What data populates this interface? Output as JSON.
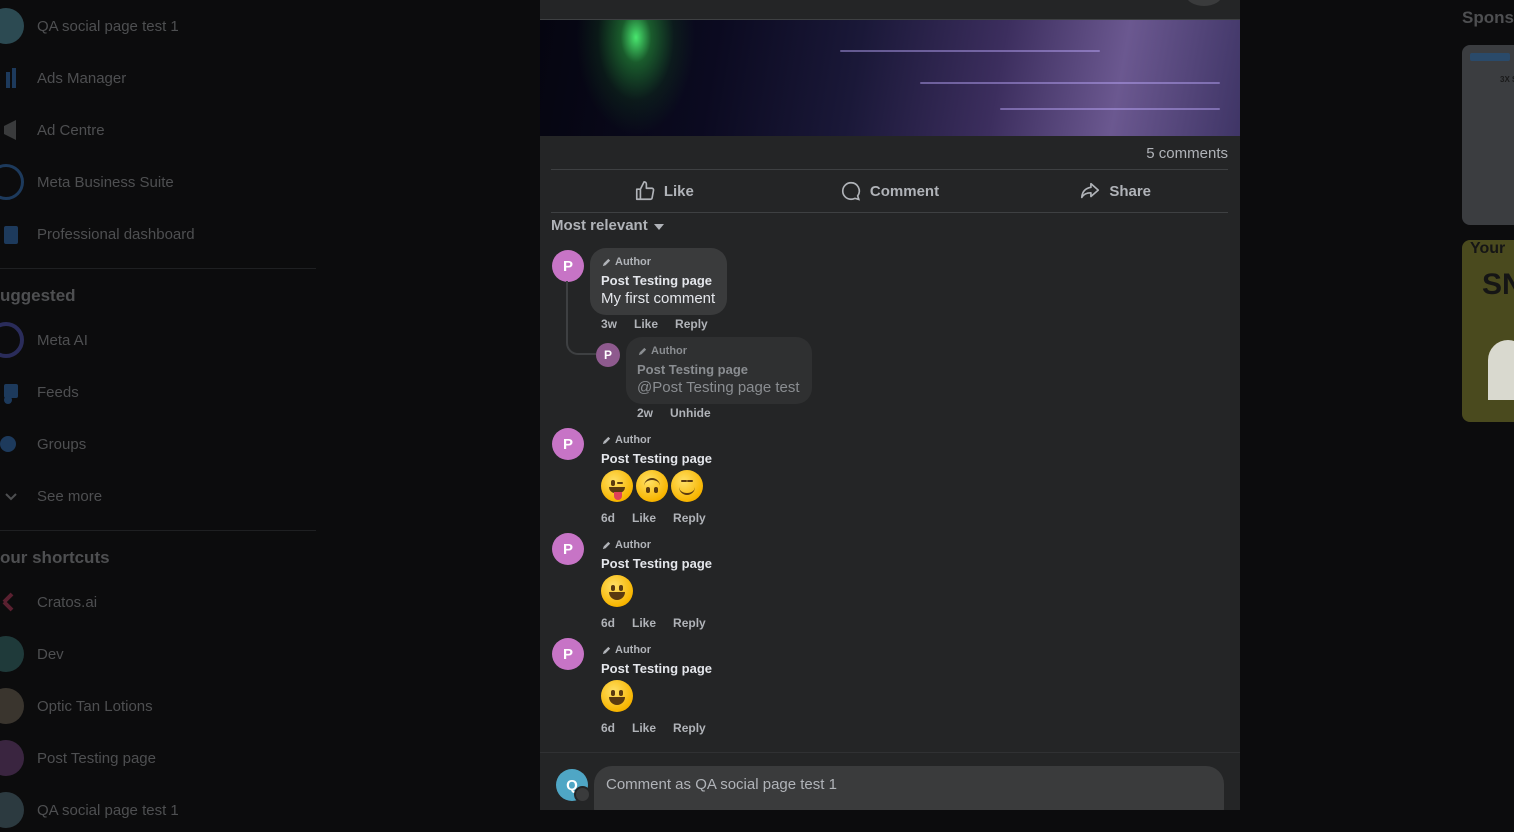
{
  "sidebar": {
    "items": [
      {
        "label": "QA social page test 1",
        "icon": "qa-avatar-icon"
      },
      {
        "label": "Ads Manager",
        "icon": "bar-chart-icon"
      },
      {
        "label": "Ad Centre",
        "icon": "megaphone-icon"
      },
      {
        "label": "Meta Business Suite",
        "icon": "business-suite-icon"
      },
      {
        "label": "Professional dashboard",
        "icon": "dashboard-icon"
      }
    ],
    "suggested_title": "uggested",
    "suggested": [
      {
        "label": "Meta AI",
        "icon": "meta-ai-icon"
      },
      {
        "label": "Feeds",
        "icon": "feeds-icon"
      },
      {
        "label": "Groups",
        "icon": "groups-icon"
      },
      {
        "label": "See more",
        "icon": "chevron-down-icon"
      }
    ],
    "shortcuts_title": "our shortcuts",
    "shortcuts": [
      {
        "label": "Cratos.ai",
        "icon": "cratos-icon"
      },
      {
        "label": "Dev",
        "icon": "dev-avatar-icon"
      },
      {
        "label": "Optic Tan Lotions",
        "icon": "optic-avatar-icon"
      },
      {
        "label": "Post Testing page",
        "icon": "post-testing-avatar-icon"
      },
      {
        "label": "QA social page test 1",
        "icon": "qa-avatar-icon"
      }
    ]
  },
  "right": {
    "sponsored_title": "Spons",
    "ad1_text": "3X Sol",
    "ad2_text": "Your",
    "ad2_big": "SN"
  },
  "post": {
    "comments_count": "5 comments",
    "actions": {
      "like": "Like",
      "comment": "Comment",
      "share": "Share"
    },
    "sort_label": "Most relevant"
  },
  "comments": [
    {
      "avatar": "P",
      "author_tag": "Author",
      "name": "Post Testing page",
      "text": "My first comment",
      "time": "3w",
      "like": "Like",
      "reply": "Reply"
    },
    {
      "avatar": "P",
      "author_tag": "Author",
      "name": "Post Testing page",
      "text": "@Post Testing page test",
      "time": "2w",
      "unhide": "Unhide",
      "hidden": true
    },
    {
      "avatar": "P",
      "author_tag": "Author",
      "name": "Post Testing page",
      "emojis": [
        "winking-face-with-tongue",
        "upside-down-face",
        "smiling-face"
      ],
      "time": "6d",
      "like": "Like",
      "reply": "Reply"
    },
    {
      "avatar": "P",
      "author_tag": "Author",
      "name": "Post Testing page",
      "emojis": [
        "grinning-face"
      ],
      "time": "6d",
      "like": "Like",
      "reply": "Reply"
    },
    {
      "avatar": "P",
      "author_tag": "Author",
      "name": "Post Testing page",
      "emojis": [
        "grinning-face"
      ],
      "time": "6d",
      "like": "Like",
      "reply": "Reply"
    }
  ],
  "composer": {
    "avatar": "Q",
    "placeholder": "Comment as QA social page test 1"
  },
  "colors": {
    "modal_bg": "#242526",
    "bubble_bg": "#3a3b3c",
    "avatar_page": "#c774c6",
    "avatar_qa": "#4fa6c5"
  }
}
